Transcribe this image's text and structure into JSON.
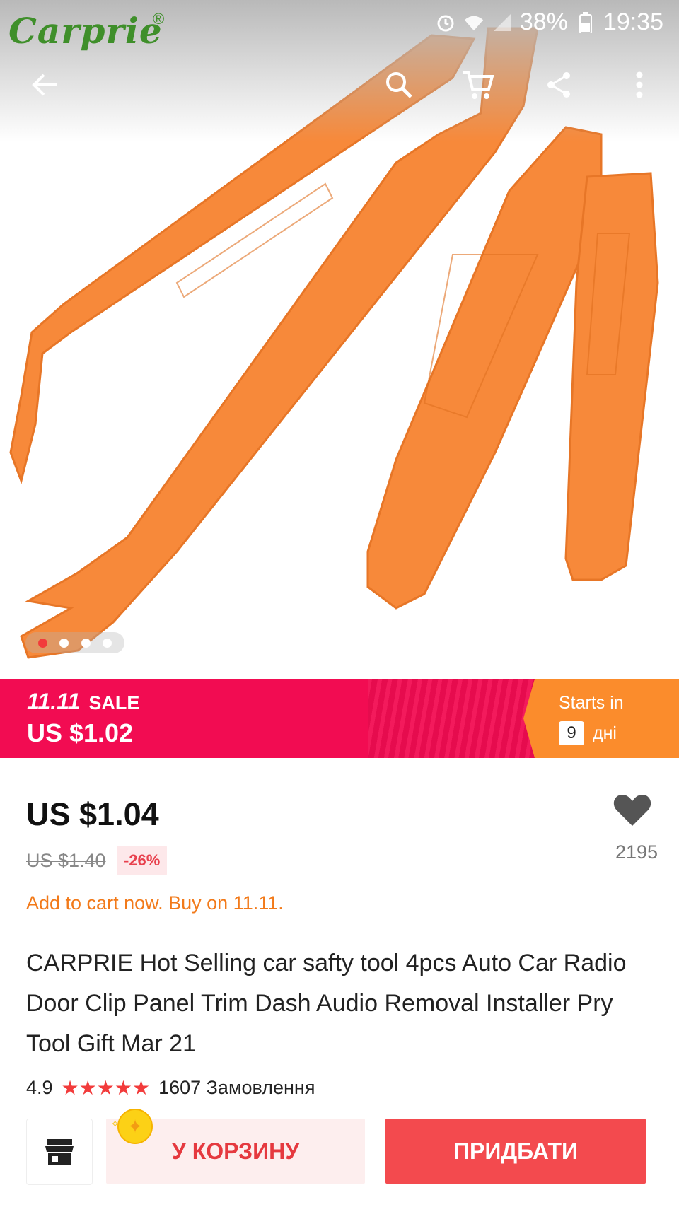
{
  "brand": {
    "name": "Carprie",
    "reg": "®"
  },
  "status_bar": {
    "battery": "38%",
    "time": "19:35"
  },
  "toolbar": {
    "back_icon": "arrow-left-icon",
    "search_icon": "search-icon",
    "cart_icon": "cart-icon",
    "share_icon": "share-icon",
    "more_icon": "more-vertical-icon"
  },
  "gallery": {
    "page_count": 4,
    "active_index": 0
  },
  "sale_banner": {
    "event": "11.11",
    "label": "SALE",
    "price": "US $1.02",
    "starts_label": "Starts in",
    "count": "9",
    "unit": "дні",
    "colors": {
      "left": "#f20c52",
      "right": "#fb8c2c"
    }
  },
  "product": {
    "price": "US $1.04",
    "original_price": "US $1.40",
    "discount": "-26%",
    "wishlist_count": "2195",
    "promo": "Add to cart now. Buy on 11.11.",
    "title": "CARPRIE Hot Selling car safty tool 4pcs Auto Car Radio Door Clip Panel Trim Dash Audio Removal Installer Pry Tool Gift Mar 21",
    "rating": "4.9",
    "stars": "★★★★★",
    "orders": "1607 Замовлення"
  },
  "actions": {
    "store_icon": "store-icon",
    "add_to_cart": "У КОРЗИНУ",
    "buy_now": "ПРИДБАТИ",
    "accent": "#f34a4e"
  }
}
